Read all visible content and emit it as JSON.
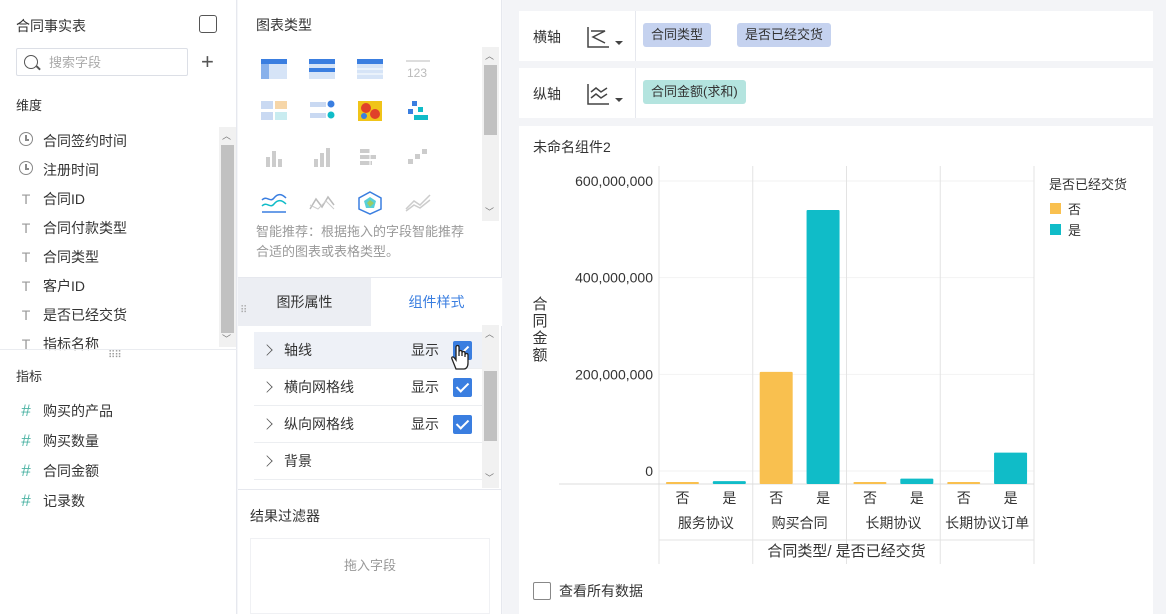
{
  "left_panel": {
    "title": "合同事实表",
    "search_placeholder": "搜索字段",
    "dimensions_title": "维度",
    "dimensions": [
      {
        "icon": "clock-icon",
        "label": "合同签约时间"
      },
      {
        "icon": "clock-icon",
        "label": "注册时间"
      },
      {
        "icon": "text-icon",
        "label": "合同ID"
      },
      {
        "icon": "text-icon",
        "label": "合同付款类型"
      },
      {
        "icon": "text-icon",
        "label": "合同类型"
      },
      {
        "icon": "text-icon",
        "label": "客户ID"
      },
      {
        "icon": "text-icon",
        "label": "是否已经交货"
      },
      {
        "icon": "text-icon",
        "label": "指标名称"
      }
    ],
    "metrics_title": "指标",
    "metrics": [
      {
        "label": "购买的产品"
      },
      {
        "label": "购买数量"
      },
      {
        "label": "合同金额"
      },
      {
        "label": "记录数"
      }
    ]
  },
  "mid_panel": {
    "chart_types_title": "图表类型",
    "smart_hint": "智能推荐：根据拖入的字段智能推荐合适的图表或表格类型。",
    "tabs": [
      {
        "label": "图形属性"
      },
      {
        "label": "组件样式"
      }
    ],
    "props": [
      {
        "label": "轴线",
        "show": "显示",
        "checked": true
      },
      {
        "label": "横向网格线",
        "show": "显示",
        "checked": true
      },
      {
        "label": "纵向网格线",
        "show": "显示",
        "checked": true
      },
      {
        "label": "背景",
        "show": "",
        "checked": false
      }
    ],
    "filter_title": "结果过滤器",
    "filter_placeholder": "拖入字段"
  },
  "axes": {
    "x_label": "横轴",
    "x_fields": [
      "合同类型",
      "是否已经交货"
    ],
    "y_label": "纵轴",
    "y_fields": [
      "合同金额(求和)"
    ]
  },
  "chart_card": {
    "title": "未命名组件2",
    "view_all_label": "查看所有数据"
  },
  "chart_data": {
    "type": "bar",
    "categories": [
      "服务协议",
      "购买合同",
      "长期协议",
      "长期协议订单"
    ],
    "sub_categories": [
      "否",
      "是"
    ],
    "series": [
      {
        "name": "否",
        "color": "#f9c04f",
        "values": [
          2000000,
          232000000,
          3500000,
          1500000
        ]
      },
      {
        "name": "是",
        "color": "#10bcc8",
        "values": [
          6000000,
          567000000,
          11000000,
          65000000
        ]
      }
    ],
    "ylabel": "合同金额",
    "xlabel": "合同类型/ 是否已经交货",
    "legend_title": "是否已经交货",
    "yticks": [
      "0",
      "200,000,000",
      "400,000,000",
      "600,000,000"
    ],
    "ylim": [
      0,
      600000000
    ],
    "legend_position": "top-right",
    "grid": true
  }
}
